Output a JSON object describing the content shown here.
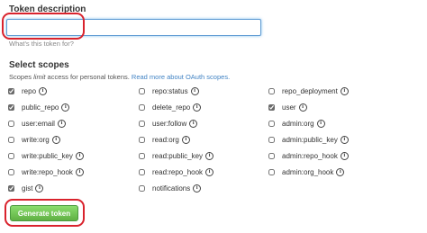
{
  "token": {
    "title": "Token description",
    "value": "",
    "placeholder": "",
    "help_link": "What's this token for?"
  },
  "scopes": {
    "title": "Select scopes",
    "desc_prefix": "Scopes ",
    "desc_emph": "limit",
    "desc_middle": " access for personal tokens. ",
    "desc_link": "Read more about OAuth scopes.",
    "items": [
      {
        "label": "repo",
        "checked": true
      },
      {
        "label": "repo:status",
        "checked": false
      },
      {
        "label": "repo_deployment",
        "checked": false
      },
      {
        "label": "public_repo",
        "checked": true
      },
      {
        "label": "delete_repo",
        "checked": false
      },
      {
        "label": "user",
        "checked": true
      },
      {
        "label": "user:email",
        "checked": false
      },
      {
        "label": "user:follow",
        "checked": false
      },
      {
        "label": "admin:org",
        "checked": false
      },
      {
        "label": "write:org",
        "checked": false
      },
      {
        "label": "read:org",
        "checked": false
      },
      {
        "label": "admin:public_key",
        "checked": false
      },
      {
        "label": "write:public_key",
        "checked": false
      },
      {
        "label": "read:public_key",
        "checked": false
      },
      {
        "label": "admin:repo_hook",
        "checked": false
      },
      {
        "label": "write:repo_hook",
        "checked": false
      },
      {
        "label": "read:repo_hook",
        "checked": false
      },
      {
        "label": "admin:org_hook",
        "checked": false
      },
      {
        "label": "gist",
        "checked": true
      },
      {
        "label": "notifications",
        "checked": false
      }
    ]
  },
  "actions": {
    "generate_label": "Generate token"
  },
  "colors": {
    "annotation": "#d9232d",
    "button_green": "#60b044",
    "link_blue": "#4183c4"
  },
  "icons": {
    "info": "info-circle-icon"
  }
}
